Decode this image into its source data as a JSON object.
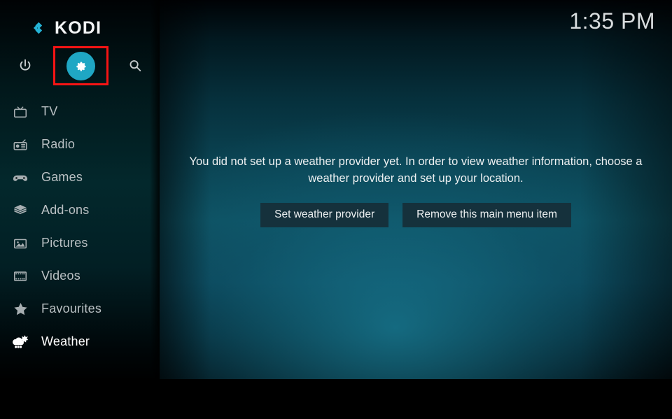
{
  "app": {
    "name": "KODI",
    "logo_icon": "kodi-logo-icon"
  },
  "header": {
    "clock": "1:35 PM"
  },
  "top_bar": {
    "buttons": [
      {
        "name": "power",
        "label": "Power",
        "icon": "power-icon"
      },
      {
        "name": "settings",
        "label": "Settings",
        "icon": "gear-icon",
        "highlighted": true
      },
      {
        "name": "search",
        "label": "Search",
        "icon": "search-icon"
      }
    ]
  },
  "annotation": {
    "color": "#f61414",
    "target": "settings-button"
  },
  "sidebar": {
    "items": [
      {
        "label": "TV",
        "icon": "tv-icon",
        "selected": false
      },
      {
        "label": "Radio",
        "icon": "radio-icon",
        "selected": false
      },
      {
        "label": "Games",
        "icon": "gamepad-icon",
        "selected": false
      },
      {
        "label": "Add-ons",
        "icon": "addons-box-icon",
        "selected": false
      },
      {
        "label": "Pictures",
        "icon": "picture-icon",
        "selected": false
      },
      {
        "label": "Videos",
        "icon": "film-strip-icon",
        "selected": false
      },
      {
        "label": "Favourites",
        "icon": "star-icon",
        "selected": false
      },
      {
        "label": "Weather",
        "icon": "weather-icon",
        "selected": true
      }
    ]
  },
  "main": {
    "notice": "You did not set up a weather provider yet. In order to view weather information, choose a weather provider and set up your location.",
    "buttons": {
      "set_provider": "Set weather provider",
      "remove_item": "Remove this main menu item"
    }
  },
  "colors": {
    "accent_cyan": "#1fa7c4",
    "annotation_red": "#f61414",
    "button_bg": "#15313c",
    "background_teal": "#0d4f5f"
  }
}
